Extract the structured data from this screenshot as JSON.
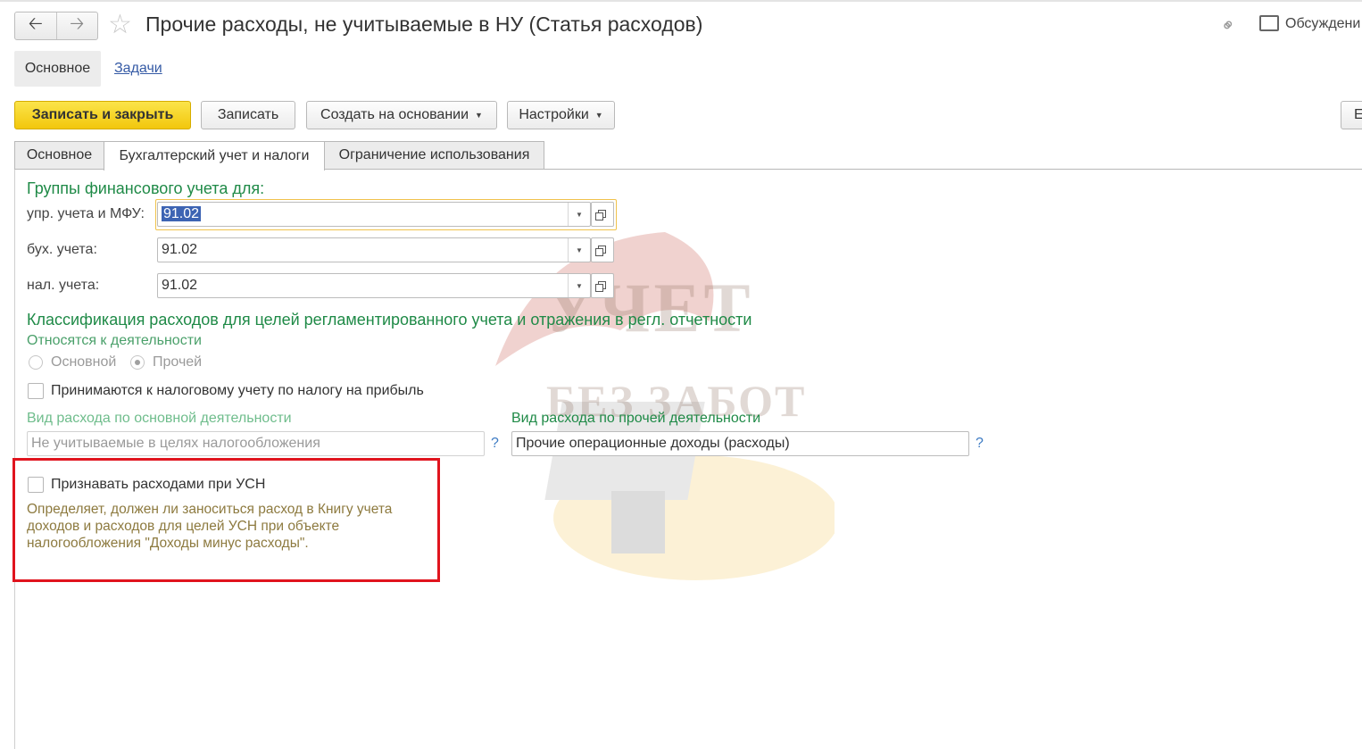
{
  "window": {
    "title": "Прочие расходы, не учитываемые в НУ (Статья расходов)",
    "discuss_label": "Обсуждени"
  },
  "nav_tabs": [
    {
      "label": "Основное",
      "active": true
    },
    {
      "label": "Задачи",
      "active": false
    }
  ],
  "toolbar": {
    "save_close": "Записать и закрыть",
    "save": "Записать",
    "create_based": "Создать на основании",
    "settings": "Настройки",
    "more_partial": "Е"
  },
  "form_tabs": [
    {
      "label": "Основное",
      "active": false
    },
    {
      "label": "Бухгалтерский учет и налоги",
      "active": true
    },
    {
      "label": "Ограничение использования",
      "active": false
    }
  ],
  "groups": {
    "heading": "Группы финансового учета для:",
    "mgmt_label": "упр. учета и МФУ:",
    "mgmt_value": "91.02",
    "acc_label": "бух. учета:",
    "acc_value": "91.02",
    "tax_label": "нал. учета:",
    "tax_value": "91.02"
  },
  "classification": {
    "heading": "Классификация расходов для целей регламентированного учета и отражения в регл. отчетности",
    "activity_label": "Относятся к деятельности",
    "radio_main": "Основной",
    "radio_other": "Прочей",
    "selected": "Прочей",
    "profit_tax_label": "Принимаются к налоговому учету по налогу на прибыль",
    "profit_tax_checked": false,
    "main_expense_label": "Вид расхода по основной деятельности",
    "main_expense_value": "Не учитываемые в целях налогообложения",
    "other_expense_label": "Вид расхода по прочей деятельности",
    "other_expense_value": "Прочие операционные доходы (расходы)",
    "help": "?"
  },
  "usn": {
    "label": "Признавать расходами при УСН",
    "checked": false,
    "description": "Определяет, должен ли заноситься расход в Книгу учета доходов и расходов для целей УСН при объекте налогообложения \"Доходы минус расходы\"."
  },
  "watermark": {
    "line1": "УЧЕТ",
    "line2": "БЕЗ ЗАБОТ"
  },
  "colors": {
    "accent_green": "#1f8a47",
    "primary_button": "#f2c70d",
    "highlight_box": "#e0141e",
    "link": "#355aa5"
  }
}
